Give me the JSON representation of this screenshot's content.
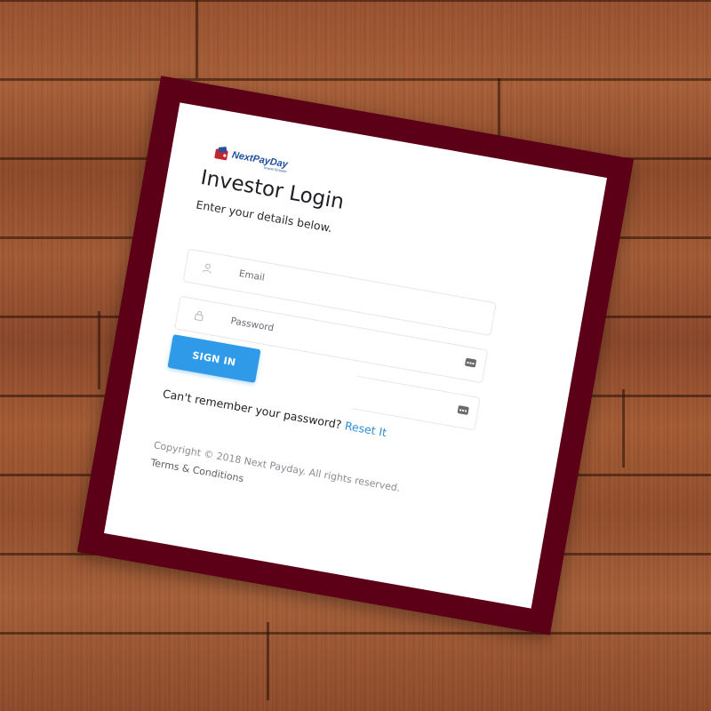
{
  "brand": {
    "logo_text": "NextPayDay",
    "logo_subtext": "Invest Smarter",
    "logo_color": "#1f4f9c"
  },
  "login": {
    "title": "Investor Login",
    "subtitle": "Enter your details below.",
    "email_placeholder": "Email",
    "password_placeholder": "Password",
    "signin_label": "SIGN IN",
    "forgot_text": "Can't remember your password?",
    "reset_label": "Reset It"
  },
  "footer": {
    "copyright": "Copyright © 2018 Next Payday. All rights reserved.",
    "terms_label": "Terms & Conditions"
  },
  "icons": {
    "email": "user-icon",
    "password": "lock-icon",
    "autofill": "keyboard-icon"
  },
  "colors": {
    "frame": "#5c0018",
    "button": "#2f9be8",
    "link": "#2f8fd8",
    "background_wood": "#9a5230"
  }
}
